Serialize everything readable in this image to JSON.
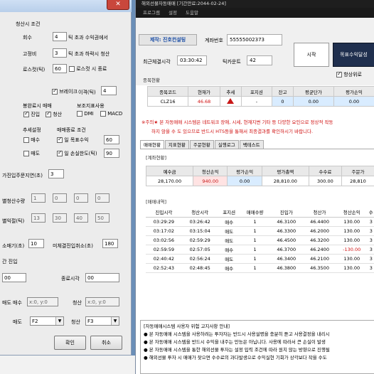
{
  "main": {
    "title": "해외선물자동매매 [기간만료:2044-02-24]",
    "menu": [
      "프로그램",
      "설정",
      "도움말"
    ],
    "company_name": "제작: 진호컨설팅",
    "account_label": "계좌번호",
    "account_number": "55555002373",
    "recent_time_label": "최근체결시각",
    "recent_time": "03:30:42",
    "tick_count_label": "틱카운트",
    "tick_count": "42",
    "start_button": "시작",
    "target_button": "목표수익달성",
    "always_on_top_label": "항상위로",
    "stock_section_title": "종목현황",
    "stock_table": {
      "headers": [
        "종목코드",
        "현재가",
        "추세",
        "포지션",
        "잔고",
        "평균단가",
        "평가손익"
      ],
      "row": [
        "CLZ16",
        "46.68",
        "",
        "-",
        "0",
        "0.00",
        "0.00"
      ]
    },
    "notice_line1": "※주의★ 본 자동매매 시스템은 네트워크 장애, 시세, 현재지변 기타 등 다양한 요인으로 정상적 작동",
    "notice_line2": "하지 않을 수 도 있으므로 반드시 HTS등을 통해서 최종결과를 확인하시기 바랍니다.",
    "tabs": [
      "매매현황",
      "지표현황",
      "주문현황",
      "실행로그",
      "백테스트"
    ],
    "account_section_title": "[계좌현황]",
    "account_table": {
      "headers": [
        "예수금",
        "청산손익",
        "평가손익",
        "평가총액",
        "수수료",
        "주문가"
      ],
      "row": [
        "28,170.00",
        "940.00",
        "0.00",
        "28,810.00",
        "300.00",
        "28,810"
      ]
    },
    "trade_section_title": "[매매내역]",
    "trade_table": {
      "headers": [
        "진입시각",
        "청산시각",
        "포지션",
        "매매수량",
        "진입가",
        "청산가",
        "청산손익",
        "수"
      ],
      "rows": [
        [
          "03:29:29",
          "03:26:42",
          "매수",
          "1",
          "46.3100",
          "46.4400",
          "130.00",
          "3"
        ],
        [
          "03:17:02",
          "03:15:04",
          "매도",
          "1",
          "46.3300",
          "46.2000",
          "130.00",
          "3"
        ],
        [
          "03:02:56",
          "02:59:29",
          "매도",
          "1",
          "46.4500",
          "46.3200",
          "130.00",
          "3"
        ],
        [
          "02:59:59",
          "02:57:05",
          "매수",
          "1",
          "46.3700",
          "46.2400",
          "-130.00",
          "3"
        ],
        [
          "02:40:42",
          "02:56:24",
          "매도",
          "1",
          "46.3400",
          "46.2100",
          "130.00",
          "3"
        ],
        [
          "02:52:43",
          "02:48:45",
          "매수",
          "1",
          "46.3800",
          "46.3500",
          "130.00",
          "3"
        ]
      ]
    },
    "risk": {
      "title": "[자동매매시스템 사용자 위험 고지사항 안내]",
      "lines": [
        "● 본 자동매매 시스템을 사용하려는 투자자는 반드시 사용설명을 충분히 듣고 사용결정을 내리시",
        "● 본 자동매매 시스템을 반드시 수익을 내주는 만능은 아닙니다. 사용에 따라서 큰 손실이 발생",
        "● 본 자동매매 시스템을 통한 해외선물 투자는 설정 입력 조건에 따라 원치 않는 방향으로 진행될",
        "● 해외선물 투자 시 매매가 잦으면 수수료의 과다발생으로 수익실현 기회가 상각보다 작을 수도"
      ]
    }
  },
  "dialog": {
    "liquidation_title": "청산시 조건",
    "count_label": "회수",
    "count_value": "4",
    "count_suffix": "틱 초과 수익권에서",
    "fixed_ratio_label": "고정비",
    "fixed_ratio_value": "3",
    "fixed_ratio_suffix": "틱 초과 하락시 청산",
    "stoploss_label": "로스컷(틱)",
    "stoploss_value": "60",
    "stoploss_suffix": "로스컷 시 종료",
    "break_label": "브레이크",
    "break_dist_label": "이격(틱)",
    "break_dist_value": "4",
    "signal_title": "봉완료시 매매",
    "signal_entry": "진입",
    "signal_exit": "청산",
    "aux_title": "보조지표사용",
    "aux_dmi": "DMI",
    "aux_macd": "MACD",
    "trend_title": "추세설정",
    "trend_buy": "매수",
    "trend_sell": "매도",
    "end_title": "매매종료 조건",
    "end_profit": "일 목표수익",
    "end_profit_value": "60",
    "end_loss": "일 손실한도(틱)",
    "end_loss_value": "90",
    "delay_label": "가진입주문지연(초)",
    "delay_value": "3",
    "qty_label": "별청산수량",
    "qty_values": [
      "1",
      "0",
      "0",
      "0"
    ],
    "profit_label": "별익절(틱)",
    "profit_values": [
      "13",
      "30",
      "40",
      "50"
    ],
    "cancel_label": "소매기(초)",
    "cancel_value": "10",
    "unfilled_label": "미체결진입취소(초)",
    "unfilled_value": "180",
    "time_entry_label": "간 진입",
    "start_time": "00",
    "end_time_label": "종료시각",
    "end_time_value": "00",
    "sell_label": "매도",
    "sell_coords": "x:0, y:0",
    "buy_label": "매수",
    "buy_coords": "x:0, y:0",
    "exit_label": "청산",
    "exit_coords": "x:0, y:0",
    "key_sell_label": "매도",
    "key_sell_value": "F2",
    "key_exit_label": "청산",
    "key_exit_value": "F3",
    "ok_button": "확인",
    "cancel_button": "취소"
  }
}
